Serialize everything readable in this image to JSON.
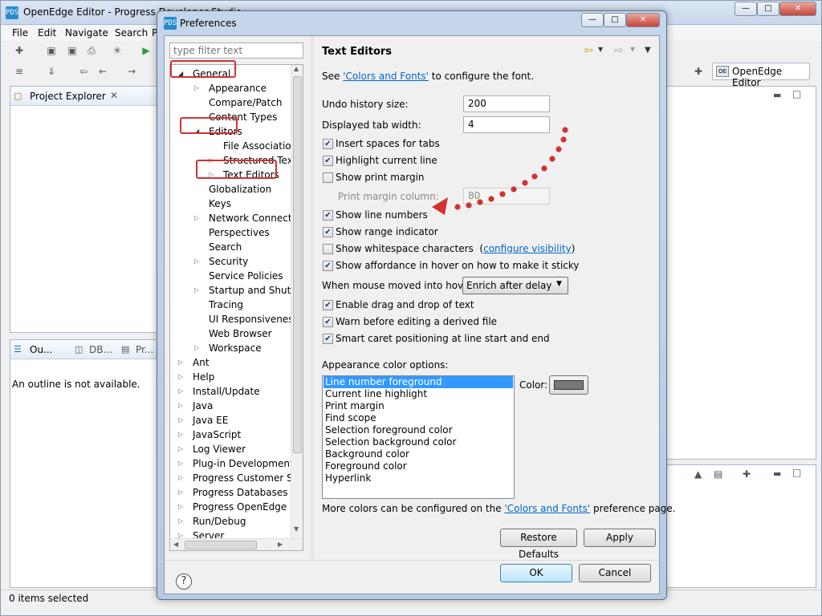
{
  "main": {
    "title": "OpenEdge Editor - Progress Developer Studio",
    "menus": [
      "File",
      "Edit",
      "Navigate",
      "Search",
      "P"
    ],
    "perspective_button": "OpenEdge Editor",
    "project_explorer_tab": "Project Explorer",
    "outline_tabs": [
      "Ou...",
      "DB...",
      "Pr..."
    ],
    "outline_message": "An outline is not available.",
    "status": "0 items selected"
  },
  "dialog": {
    "title": "Preferences",
    "filter_placeholder": "type filter text",
    "tree": [
      {
        "label": "General",
        "level": 0,
        "expanded": true
      },
      {
        "label": "Appearance",
        "level": 1,
        "expandable": true
      },
      {
        "label": "Compare/Patch",
        "level": 1
      },
      {
        "label": "Content Types",
        "level": 1
      },
      {
        "label": "Editors",
        "level": 1,
        "expanded": true
      },
      {
        "label": "File Associations",
        "level": 2
      },
      {
        "label": "Structured Text E",
        "level": 2,
        "expandable": true
      },
      {
        "label": "Text Editors",
        "level": 2,
        "expandable": true,
        "selected": true
      },
      {
        "label": "Globalization",
        "level": 1
      },
      {
        "label": "Keys",
        "level": 1
      },
      {
        "label": "Network Connection",
        "level": 1,
        "expandable": true
      },
      {
        "label": "Perspectives",
        "level": 1
      },
      {
        "label": "Search",
        "level": 1
      },
      {
        "label": "Security",
        "level": 1,
        "expandable": true
      },
      {
        "label": "Service Policies",
        "level": 1
      },
      {
        "label": "Startup and Shutdov",
        "level": 1,
        "expandable": true
      },
      {
        "label": "Tracing",
        "level": 1
      },
      {
        "label": "UI Responsiveness M",
        "level": 1
      },
      {
        "label": "Web Browser",
        "level": 1
      },
      {
        "label": "Workspace",
        "level": 1,
        "expandable": true
      },
      {
        "label": "Ant",
        "level": 0,
        "expandable": true
      },
      {
        "label": "Help",
        "level": 0,
        "expandable": true
      },
      {
        "label": "Install/Update",
        "level": 0,
        "expandable": true
      },
      {
        "label": "Java",
        "level": 0,
        "expandable": true
      },
      {
        "label": "Java EE",
        "level": 0,
        "expandable": true
      },
      {
        "label": "JavaScript",
        "level": 0,
        "expandable": true
      },
      {
        "label": "Log Viewer",
        "level": 0,
        "expandable": true
      },
      {
        "label": "Plug-in Development",
        "level": 0,
        "expandable": true
      },
      {
        "label": "Progress Customer Supp",
        "level": 0,
        "expandable": true
      },
      {
        "label": "Progress Databases",
        "level": 0,
        "expandable": true
      },
      {
        "label": "Progress OpenEdge",
        "level": 0,
        "expandable": true
      },
      {
        "label": "Run/Debug",
        "level": 0,
        "expandable": true
      },
      {
        "label": "Server",
        "level": 0,
        "expandable": true
      }
    ],
    "page_title": "Text Editors",
    "intro_prefix": "See ",
    "intro_link": "'Colors and Fonts'",
    "intro_suffix": " to configure the font.",
    "undo_label": "Undo history size:",
    "undo_value": "200",
    "tab_width_label": "Displayed tab width:",
    "tab_width_value": "4",
    "checks1": [
      {
        "label": "Insert spaces for tabs",
        "checked": true
      },
      {
        "label": "Highlight current line",
        "checked": true
      },
      {
        "label": "Show print margin",
        "checked": false
      }
    ],
    "print_margin_label": "Print margin column:",
    "print_margin_value": "80",
    "checks2": [
      {
        "label": "Show line numbers",
        "checked": true
      },
      {
        "label": "Show range indicator",
        "checked": true
      }
    ],
    "whitespace_label": "Show whitespace characters",
    "whitespace_checked": false,
    "whitespace_link": "configure visibility",
    "affordance_label": "Show affordance in hover on how to make it sticky",
    "affordance_checked": true,
    "hover_label": "When mouse moved into hover:",
    "hover_value": "Enrich after delay",
    "checks3": [
      {
        "label": "Enable drag and drop of text",
        "checked": true
      },
      {
        "label": "Warn before editing a derived file",
        "checked": true
      },
      {
        "label": "Smart caret positioning at line start and end",
        "checked": true
      }
    ],
    "color_options_label": "Appearance color options:",
    "color_options": [
      "Line number foreground",
      "Current line highlight",
      "Print margin",
      "Find scope",
      "Selection foreground color",
      "Selection background color",
      "Background color",
      "Foreground color",
      "Hyperlink"
    ],
    "color_label": "Color:",
    "swatch_color": "#787878",
    "more_prefix": "More colors can be configured on the ",
    "more_link": "'Colors and Fonts'",
    "more_suffix": " preference page.",
    "restore_defaults": "Restore Defaults",
    "apply": "Apply",
    "ok": "OK",
    "cancel": "Cancel"
  }
}
